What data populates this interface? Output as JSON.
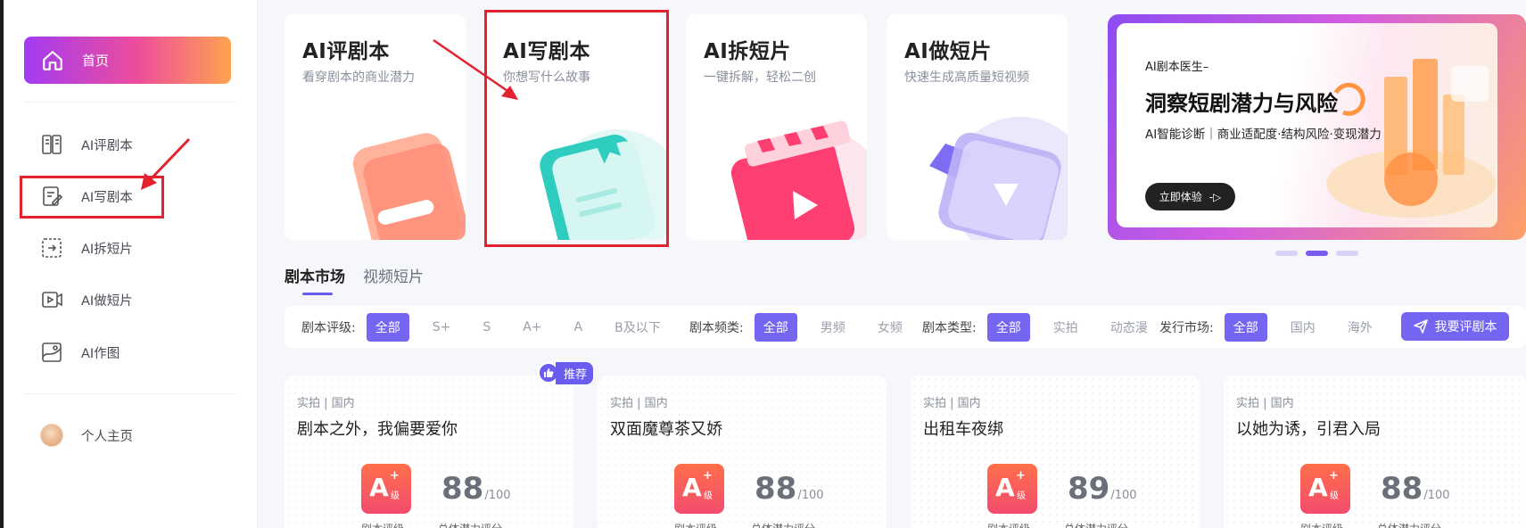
{
  "sidebar": {
    "home": "首页",
    "items": [
      {
        "label": "AI评剧本",
        "icon": "book-review-icon"
      },
      {
        "label": "AI写剧本",
        "icon": "edit-document-icon"
      },
      {
        "label": "AI拆短片",
        "icon": "split-frame-icon"
      },
      {
        "label": "AI做短片",
        "icon": "video-icon"
      },
      {
        "label": "AI作图",
        "icon": "image-edit-icon"
      }
    ],
    "profile": "个人主页"
  },
  "cards": [
    {
      "title": "AI评剧本",
      "subtitle": "看穿剧本的商业潜力"
    },
    {
      "title": "AI写剧本",
      "subtitle": "你想写什么故事"
    },
    {
      "title": "AI拆短片",
      "subtitle": "一键拆解，轻松二创"
    },
    {
      "title": "AI做短片",
      "subtitle": "快速生成高质量短视频"
    }
  ],
  "banner": {
    "kicker": "AI剧本医生–",
    "headline": "洞察短剧潜力与风险",
    "description": "AI智能诊断｜商业适配度·结构风险·变现潜力",
    "cta": "立即体验",
    "cta_arrow": "-▷",
    "slide_count": 3,
    "active_slide": 2
  },
  "tabs": [
    "剧本市场",
    "视频短片"
  ],
  "filters": {
    "rating": {
      "label": "剧本评级:",
      "options": [
        "全部",
        "S+",
        "S",
        "A+",
        "A",
        "B及以下"
      ]
    },
    "channel": {
      "label": "剧本频类:",
      "options": [
        "全部",
        "男频",
        "女频"
      ]
    },
    "type": {
      "label": "剧本类型:",
      "options": [
        "全部",
        "实拍",
        "动态漫"
      ]
    },
    "market": {
      "label": "发行市场:",
      "options": [
        "全部",
        "国内",
        "海外"
      ]
    },
    "evaluate_button": "我要评剧本"
  },
  "recommend_badge": "推荐",
  "scripts": [
    {
      "meta": "实拍 | 国内",
      "name": "剧本之外，我偏要爱你",
      "grade": "A",
      "grade_plus": "+",
      "grade_suffix": "级",
      "score": "88",
      "score_max": "/100",
      "grade_caption": "剧本评级",
      "score_caption": "总体潜力评分"
    },
    {
      "meta": "实拍 | 国内",
      "name": "双面魔尊茶又娇",
      "grade": "A",
      "grade_plus": "+",
      "grade_suffix": "级",
      "score": "88",
      "score_max": "/100",
      "grade_caption": "剧本评级",
      "score_caption": "总体潜力评分"
    },
    {
      "meta": "实拍 | 国内",
      "name": "出租车夜绑",
      "grade": "A",
      "grade_plus": "+",
      "grade_suffix": "级",
      "score": "89",
      "score_max": "/100",
      "grade_caption": "剧本评级",
      "score_caption": "总体潜力评分"
    },
    {
      "meta": "实拍 | 国内",
      "name": "以她为诱，引君入局",
      "grade": "A",
      "grade_plus": "+",
      "grade_suffix": "级",
      "score": "88",
      "score_max": "/100",
      "grade_caption": "剧本评级",
      "score_caption": "总体潜力评分"
    }
  ],
  "colors": {
    "accent": "#7566f2",
    "annotation_red": "#e3222f",
    "grade_gradient_start": "#ff6f4a",
    "grade_gradient_end": "#f24c6e"
  }
}
